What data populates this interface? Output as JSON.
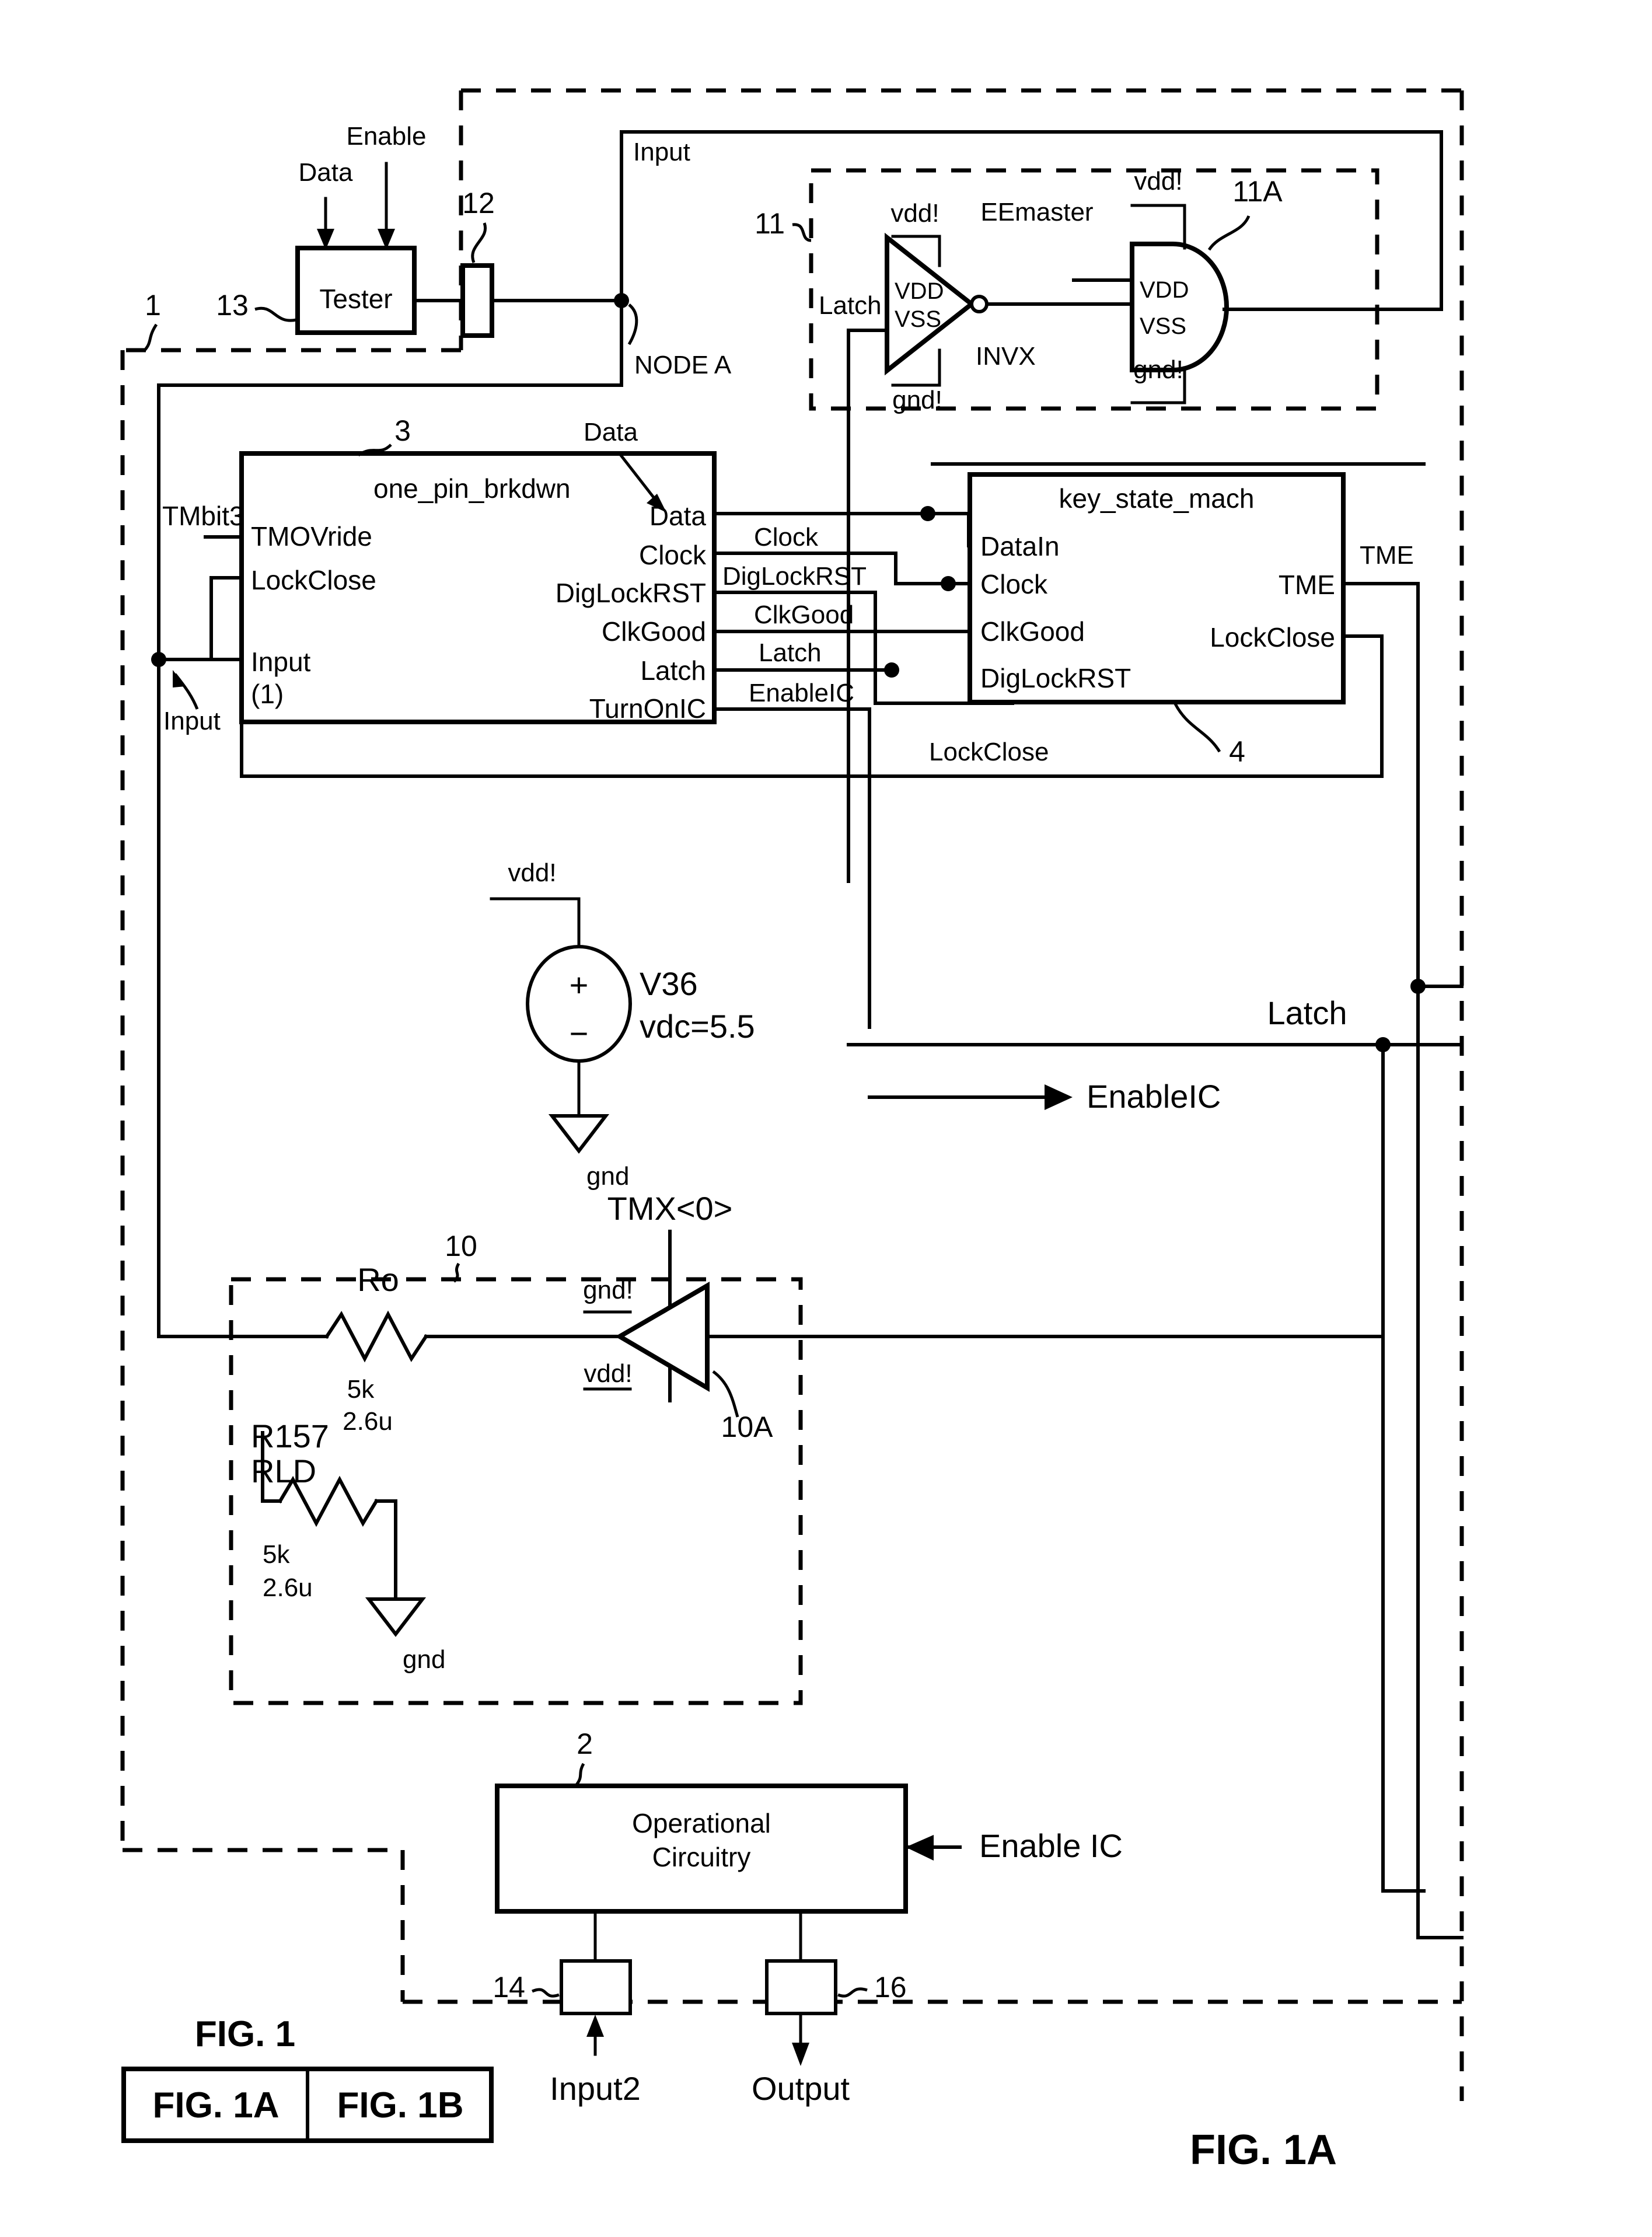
{
  "figure": {
    "title": "FIG. 1A",
    "index_title": "FIG. 1",
    "index_cells": [
      "FIG. 1A",
      "FIG. 1B"
    ]
  },
  "reference_numerals": {
    "system": "1",
    "operational_circuitry": "2",
    "one_pin_brkdwn": "3",
    "key_state_mach": "4",
    "buffer_block": "10",
    "buffer_device": "10A",
    "latch_block": "11",
    "latch_device": "11A",
    "pad": "12",
    "tester": "13",
    "input2_pad": "14",
    "output_pad": "16"
  },
  "tester": {
    "label": "Tester",
    "input_data": "Data",
    "input_enable": "Enable"
  },
  "nodes": {
    "node_a": "NODE A",
    "input_top": "Input",
    "input_left": "Input",
    "data": "Data",
    "tmx": "TMX<0>",
    "tme": "TME",
    "latch_right": "Latch",
    "lockclose_bus": "LockClose",
    "enableic_out": "EnableIC",
    "tmbit3": "TMbit3"
  },
  "latch_block": {
    "signal_in": "Latch",
    "inverter_name": "INVX",
    "inverter_vdd": "vdd!",
    "inverter_gnd": "gnd!",
    "inverter_pin_vdd": "VDD",
    "inverter_pin_vss": "VSS",
    "gate_label": "EEmaster",
    "gate_vdd": "vdd!",
    "gate_gnd": "gnd!",
    "gate_pin_vdd": "VDD",
    "gate_pin_vss": "VSS"
  },
  "one_pin_brkdwn": {
    "title": "one_pin_brkdwn",
    "inputs": [
      "TMOVride",
      "LockClose",
      "Input",
      "(1)"
    ],
    "outputs": [
      "Data",
      "Clock",
      "DigLockRST",
      "ClkGood",
      "Latch",
      "TurnOnIC"
    ]
  },
  "bus_labels": [
    "Clock",
    "DigLockRST",
    "ClkGood",
    "Latch",
    "EnableIC"
  ],
  "key_state_mach": {
    "title": "key_state_mach",
    "inputs": [
      "DataIn",
      "Clock",
      "ClkGood",
      "DigLockRST"
    ],
    "outputs": [
      "TME",
      "LockClose"
    ]
  },
  "voltage_source": {
    "rail": "vdd!",
    "name": "V36",
    "value": "vdc=5.5",
    "ground": "gnd",
    "plus": "+",
    "minus": "−"
  },
  "buffer_block": {
    "resistor_ro": {
      "name": "Ro",
      "value1": "5k",
      "value2": "2.6u"
    },
    "resistor_rld": {
      "name1": "R157",
      "name2": "RLD",
      "value1": "5k",
      "value2": "2.6u",
      "ground": "gnd"
    },
    "buffer_gnd": "gnd!",
    "buffer_vdd": "vdd!",
    "control_net": "TMX<0>"
  },
  "operational_circuitry": {
    "line1": "Operational",
    "line2": "Circuitry",
    "enable_label": "Enable IC",
    "input2_label": "Input2",
    "output_label": "Output"
  }
}
